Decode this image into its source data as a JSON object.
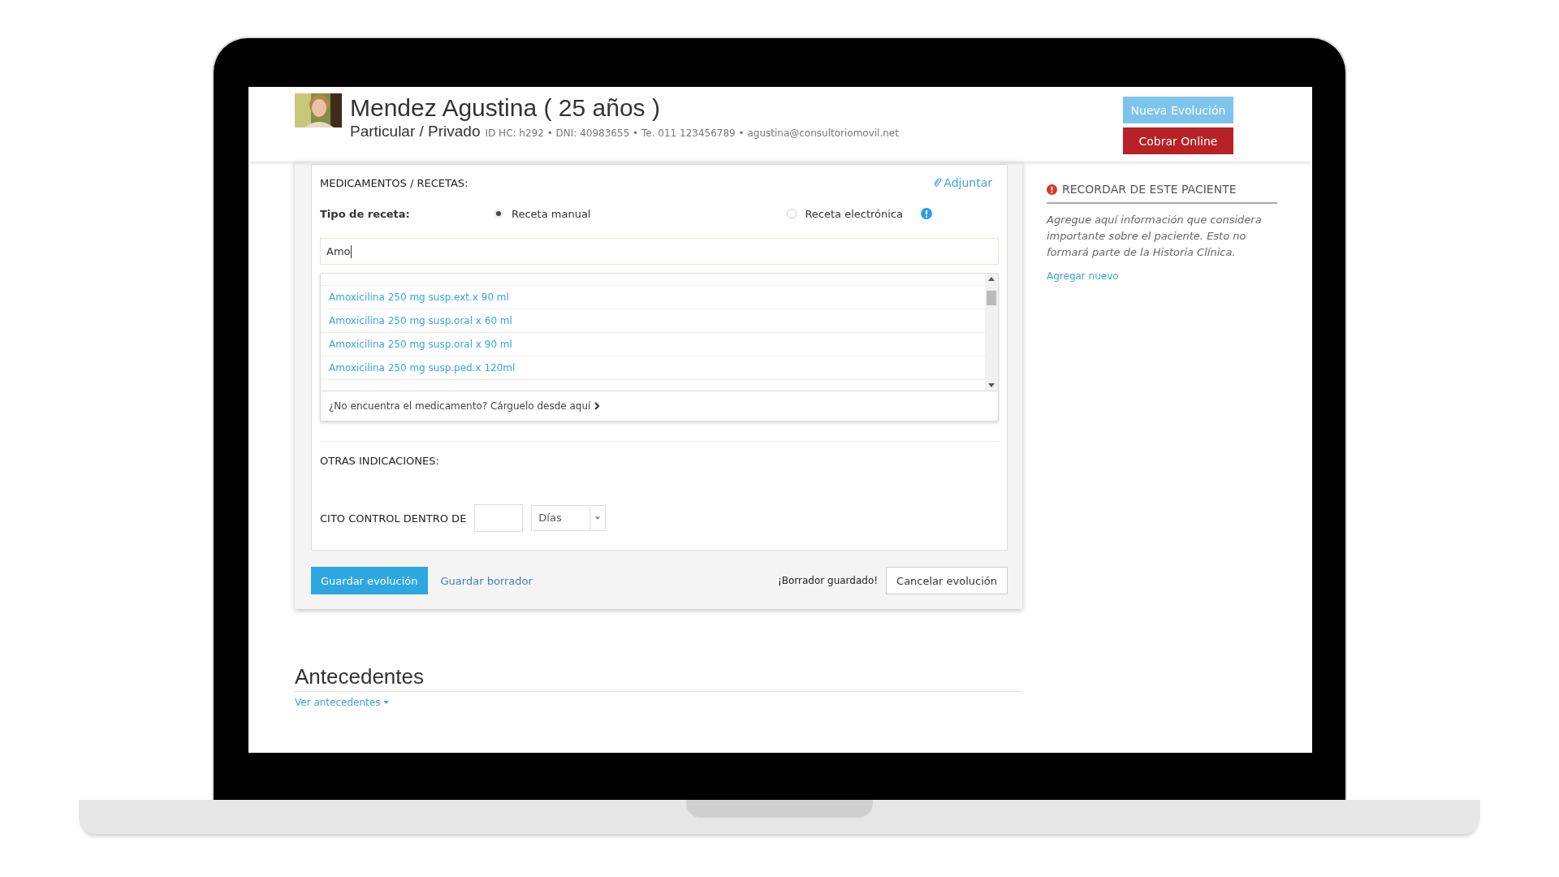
{
  "patient": {
    "name": "Mendez Agustina ( 25 años )",
    "coverage": "Particular / Privado",
    "details": "ID HC: h292 • DNI: 40983655 • Te. 011 123456789 • agustina@consultoriomovil.net"
  },
  "header_buttons": [
    {
      "label": "Nueva Evolución",
      "kind": "info"
    },
    {
      "label": "Cobrar Online",
      "kind": "danger"
    }
  ],
  "prescriptions": {
    "title": "MEDICAMENTOS / RECETAS:",
    "attach_link": "Adjuntar",
    "type_label": "Tipo de receta:",
    "types": [
      {
        "label": "Receta manual",
        "selected": true
      },
      {
        "label": "Receta electrónica",
        "selected": false
      }
    ],
    "search_value": "Amo",
    "suggestions": [
      "Amoxicilina 250 mg susp.ext.x 90 ml",
      "Amoxicilina 250 mg susp.oral x 60 ml",
      "Amoxicilina 250 mg susp.oral x 90 ml",
      "Amoxicilina 250 mg susp.ped.x 120ml"
    ],
    "not_found": "¿No encuentra el medicamento? Cárguelo desde aquí"
  },
  "other_indications": {
    "title": "OTRAS INDICACIONES:"
  },
  "control": {
    "label": "CITO CONTROL DENTRO DE",
    "unit": "Días"
  },
  "footer": {
    "save": "Guardar evolución",
    "draft": "Guardar borrador",
    "status": "¡Borrador guardado!",
    "cancel": "Cancelar evolución"
  },
  "reminder": {
    "title": "RECORDAR DE ESTE PACIENTE",
    "text": "Agregue aquí información que considera importante sobre el paciente. Esto no formará parte de la Historia Clínica.",
    "link": "Agregar nuevo"
  },
  "history": {
    "title": "Antecedentes",
    "link": "Ver antecedentes"
  }
}
